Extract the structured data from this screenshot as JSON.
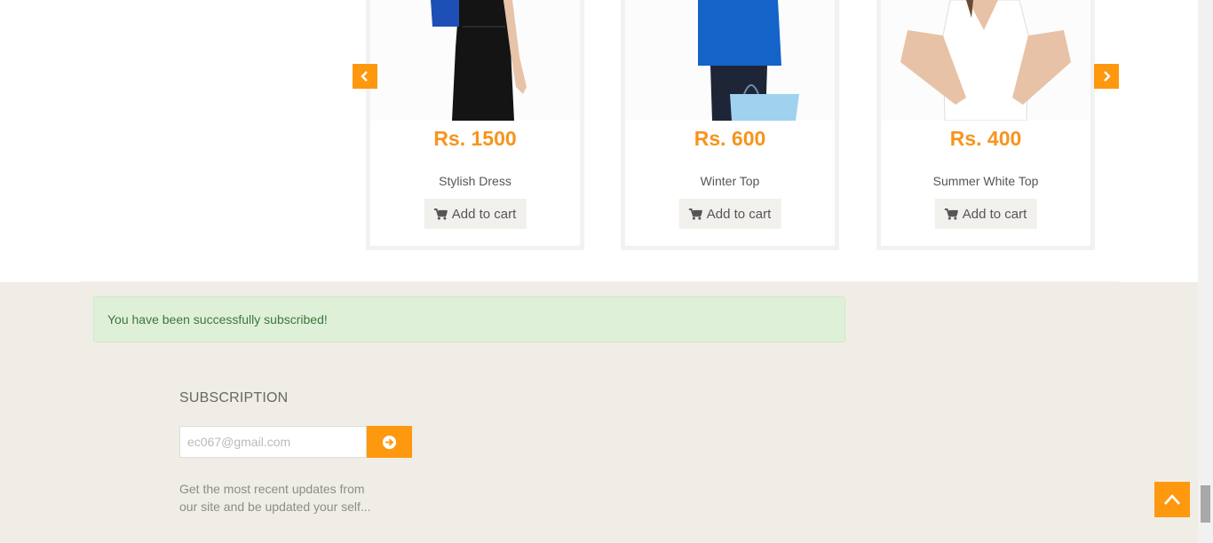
{
  "products": [
    {
      "price": "Rs. 1500",
      "name": "Stylish Dress",
      "cart_label": "Add to cart"
    },
    {
      "price": "Rs. 600",
      "name": "Winter Top",
      "cart_label": "Add to cart"
    },
    {
      "price": "Rs. 400",
      "name": "Summer White Top",
      "cart_label": "Add to cart"
    }
  ],
  "alert": {
    "message": "You have been successfully subscribed!"
  },
  "subscription": {
    "title": "SUBSCRIPTION",
    "email_value": "ec067@gmail.com",
    "description": "Get the most recent updates from our site and be updated your self..."
  },
  "colors": {
    "accent": "#fe980f",
    "price": "#f7941d",
    "alert_bg": "#dff0d8",
    "alert_text": "#3c763d",
    "footer_bg": "#efede6"
  },
  "icons": [
    "chevron-left-icon",
    "chevron-right-icon",
    "shopping-cart-icon",
    "arrow-circle-right-icon",
    "chevron-up-icon"
  ]
}
